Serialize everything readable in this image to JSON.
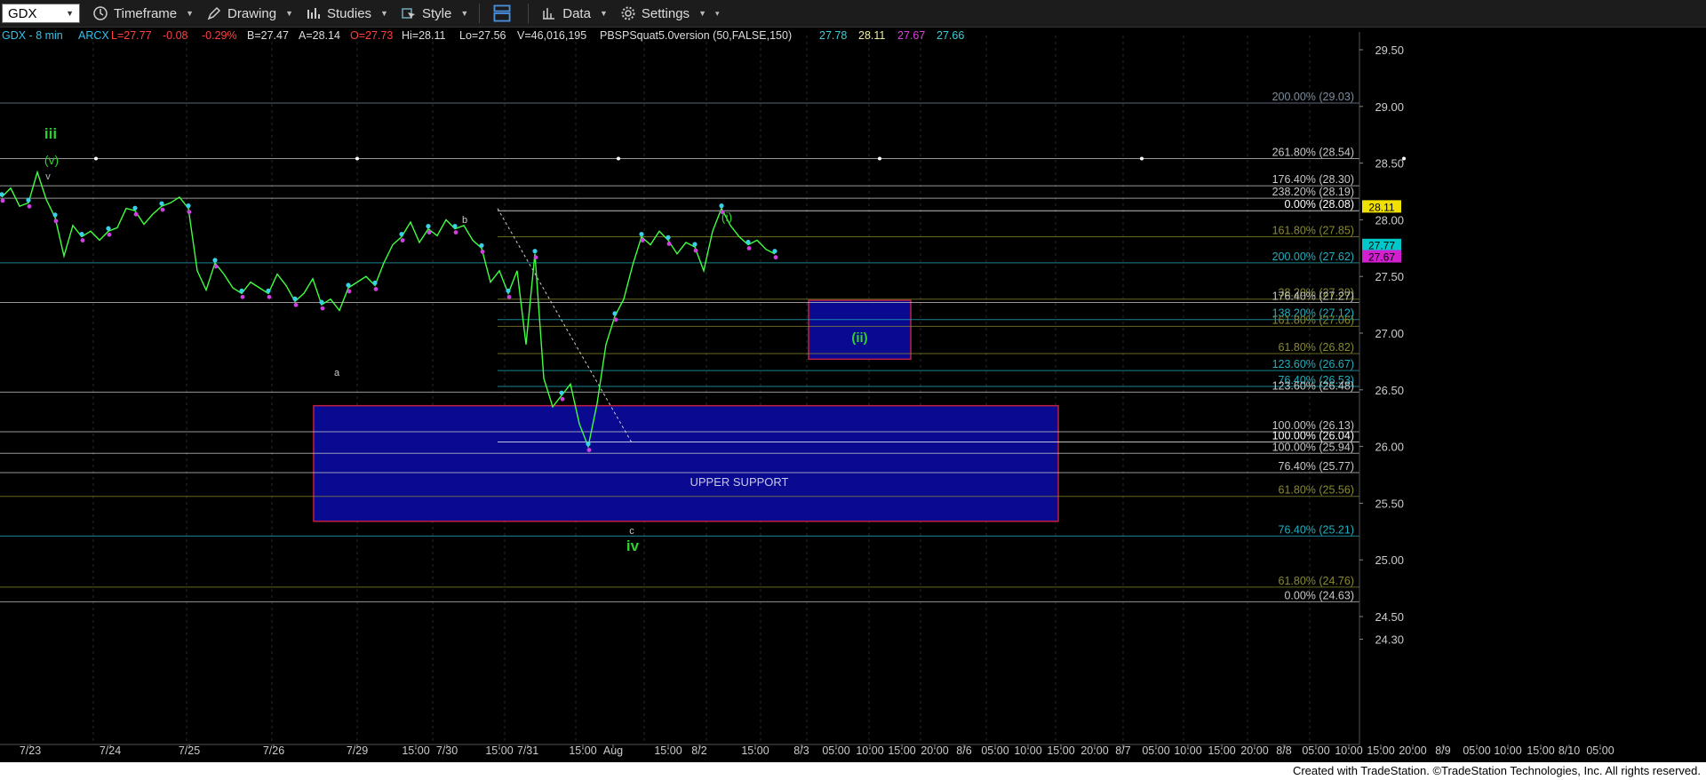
{
  "toolbar": {
    "symbol": "GDX",
    "timeframe": "Timeframe",
    "drawing": "Drawing",
    "studies": "Studies",
    "style": "Style",
    "data": "Data",
    "settings": "Settings"
  },
  "header": [
    {
      "text": "GDX - 8 min",
      "color": "#2fc4f0"
    },
    {
      "text": "ARCX",
      "color": "#2fc4f0"
    },
    {
      "text": "L=27.77",
      "color": "#ff4040"
    },
    {
      "text": "-0.08",
      "color": "#ff4040"
    },
    {
      "text": "-0.29%",
      "color": "#ff4040"
    },
    {
      "text": "B=27.47",
      "color": "#dddddd"
    },
    {
      "text": "A=28.14",
      "color": "#dddddd"
    },
    {
      "text": "O=27.73",
      "color": "#ff4040"
    },
    {
      "text": "Hi=28.11",
      "color": "#dddddd"
    },
    {
      "text": "Lo=27.56",
      "color": "#dddddd"
    },
    {
      "text": "V=46,016,195",
      "color": "#dddddd"
    },
    {
      "text": "PBSPSquat5.0version (50,FALSE,150)",
      "color": "#dddddd"
    },
    {
      "text": "27.78",
      "color": "#3ad0d8"
    },
    {
      "text": "28.11",
      "color": "#f0f0a0"
    },
    {
      "text": "27.67",
      "color": "#e040e0"
    },
    {
      "text": "27.66",
      "color": "#3ad0d8"
    }
  ],
  "footer": "Created with TradeStation. ©TradeStation Technologies, Inc. All rights reserved.",
  "chart_data": {
    "type": "line",
    "title": "GDX - 8 min",
    "ylim": [
      24.2,
      29.6
    ],
    "y_ticks": [
      "29.50",
      "29.00",
      "28.50",
      "28.00",
      "27.50",
      "27.00",
      "26.50",
      "26.00",
      "25.50",
      "25.00",
      "24.50",
      "24.30"
    ],
    "x_ticks": [
      "7/23",
      "7/24",
      "7/25",
      "7/26",
      "7/29",
      "15:00",
      "7/30",
      "15:00",
      "7/31",
      "15:00",
      "Aug",
      "15:00",
      "8/2",
      "15:00",
      "8/3",
      "05:00",
      "10:00",
      "15:00",
      "20:00",
      "8/6",
      "05:00",
      "10:00",
      "15:00",
      "20:00",
      "8/7",
      "05:00",
      "10:00",
      "15:00",
      "20:00",
      "8/8",
      "05:00",
      "10:00",
      "15:00",
      "20:00",
      "8/9",
      "05:00",
      "10:00",
      "15:00",
      "8/10",
      "05:00"
    ],
    "price_path": [
      28.2,
      28.28,
      28.12,
      28.15,
      28.42,
      28.18,
      28.02,
      27.68,
      27.95,
      27.85,
      27.9,
      27.82,
      27.9,
      27.93,
      28.1,
      28.08,
      27.96,
      28.05,
      28.12,
      28.15,
      28.2,
      28.1,
      27.55,
      27.38,
      27.62,
      27.52,
      27.4,
      27.35,
      27.45,
      27.4,
      27.35,
      27.52,
      27.42,
      27.28,
      27.35,
      27.48,
      27.25,
      27.3,
      27.2,
      27.4,
      27.45,
      27.5,
      27.42,
      27.62,
      27.78,
      27.85,
      27.98,
      27.8,
      27.92,
      27.86,
      28.0,
      27.92,
      27.95,
      27.82,
      27.75,
      27.45,
      27.55,
      27.35,
      27.55,
      26.9,
      27.7,
      26.6,
      26.35,
      26.45,
      26.55,
      26.2,
      26.0,
      26.38,
      26.9,
      27.15,
      27.3,
      27.6,
      27.85,
      27.78,
      27.9,
      27.82,
      27.7,
      27.8,
      27.76,
      27.55,
      27.9,
      28.1,
      27.95,
      27.85,
      27.78,
      27.82,
      27.74,
      27.7
    ],
    "current_price": "27.77",
    "price_labels": [
      {
        "text": "28.11",
        "value": 28.11,
        "bg": "#f0e000"
      },
      {
        "text": "27.77",
        "value": 27.77,
        "bg": "#00c8c8"
      },
      {
        "text": "27.67",
        "value": 27.67,
        "bg": "#d020d0"
      }
    ],
    "fib_levels": [
      {
        "label": "200.00% (29.03)",
        "value": 29.03,
        "color": "#7c8da0"
      },
      {
        "label": "261.80% (28.54)",
        "value": 28.54,
        "color": "#c8c8c8"
      },
      {
        "label": "176.40% (28.30)",
        "value": 28.3,
        "color": "#c8c8c8"
      },
      {
        "label": "238.20% (28.19)",
        "value": 28.19,
        "color": "#c8c8c8"
      },
      {
        "label": "0.00% (28.08)",
        "value": 28.08,
        "color": "#ffffff"
      },
      {
        "label": "161.80% (27.85)",
        "value": 27.85,
        "color": "#8a8a30"
      },
      {
        "label": "200.00% (27.62)",
        "value": 27.62,
        "color": "#20b0c0"
      },
      {
        "label": "38.20% (27.30)",
        "value": 27.3,
        "color": "#8a8a30"
      },
      {
        "label": "176.40% (27.27)",
        "value": 27.27,
        "color": "#c8c8c8"
      },
      {
        "label": "138.20% (27.12)",
        "value": 27.12,
        "color": "#20b0c0"
      },
      {
        "label": "161.80% (27.06)",
        "value": 27.06,
        "color": "#8a8a30"
      },
      {
        "label": "61.80% (26.82)",
        "value": 26.82,
        "color": "#8a8a30"
      },
      {
        "label": "123.60% (26.67)",
        "value": 26.67,
        "color": "#20b0c0"
      },
      {
        "label": "76.40% (26.53)",
        "value": 26.53,
        "color": "#20b0c0"
      },
      {
        "label": "123.60% (26.48)",
        "value": 26.48,
        "color": "#c8c8c8"
      },
      {
        "label": "100.00% (26.13)",
        "value": 26.13,
        "color": "#c8c8c8"
      },
      {
        "label": "100.00% (26.04)",
        "value": 26.04,
        "color": "#ffffff"
      },
      {
        "label": "100.00% (25.94)",
        "value": 25.94,
        "color": "#c8c8c8"
      },
      {
        "label": "76.40% (25.77)",
        "value": 25.77,
        "color": "#c8c8c8"
      },
      {
        "label": "61.80% (25.56)",
        "value": 25.56,
        "color": "#8a8a30"
      },
      {
        "label": "76.40% (25.21)",
        "value": 25.21,
        "color": "#20b0c0"
      },
      {
        "label": "61.80% (24.76)",
        "value": 24.76,
        "color": "#8a8a30"
      },
      {
        "label": "0.00% (24.63)",
        "value": 24.63,
        "color": "#c8c8c8"
      }
    ],
    "zones": [
      {
        "label": "UPPER SUPPORT",
        "y_top": 26.36,
        "y_bottom": 25.34
      },
      {
        "label": "(ii)",
        "y_top": 27.29,
        "y_bottom": 26.77
      }
    ],
    "wave_labels": [
      {
        "text": "iii",
        "color": "#30d030",
        "size": "big"
      },
      {
        "text": "(v)",
        "color": "#30d030",
        "size": "med"
      },
      {
        "text": "v",
        "color": "#b0b8c8",
        "size": "small"
      },
      {
        "text": "a",
        "color": "#c8c8c8",
        "size": "small"
      },
      {
        "text": "b",
        "color": "#c8c8c8",
        "size": "small"
      },
      {
        "text": "c",
        "color": "#c8c8c8",
        "size": "small"
      },
      {
        "text": "iv",
        "color": "#30d030",
        "size": "big"
      },
      {
        "text": "(i)",
        "color": "#30d030",
        "size": "med"
      }
    ]
  }
}
